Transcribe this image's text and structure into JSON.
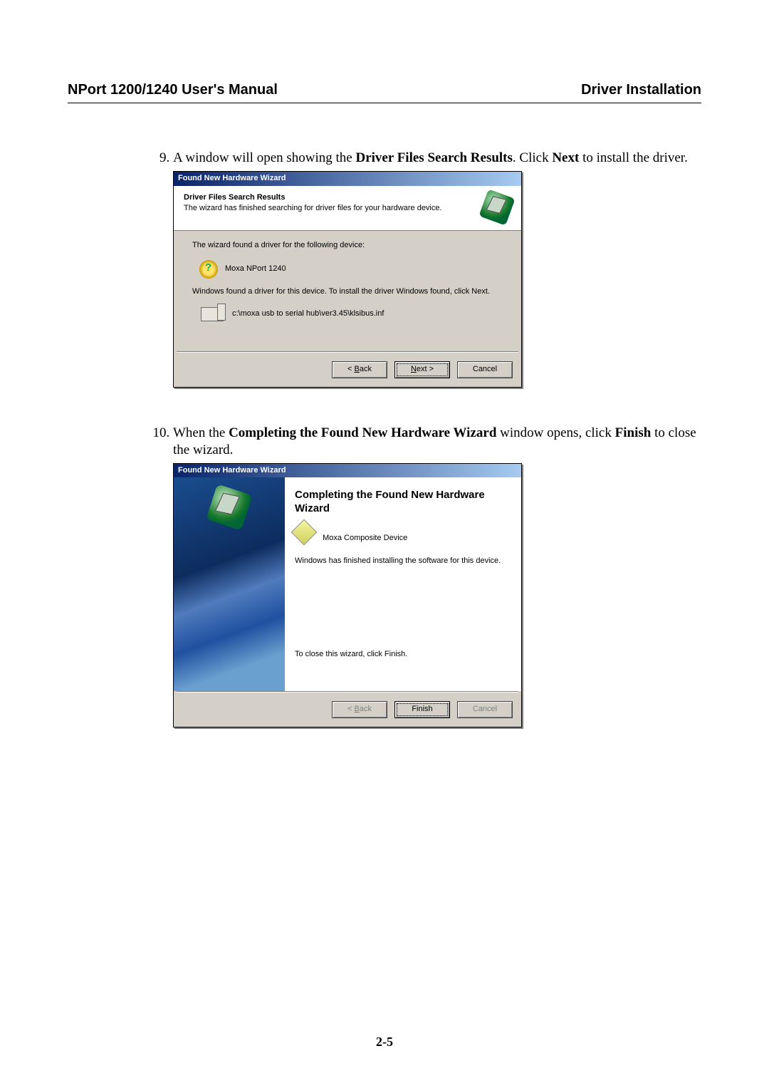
{
  "header": {
    "left": "NPort 1200/1240 User's Manual",
    "right": "Driver Installation"
  },
  "page_number": "2-5",
  "steps": {
    "s9": {
      "pre": "A window will open showing the ",
      "bold1": "Driver Files Search Results",
      "mid": ". Click ",
      "bold2": "Next",
      "post": " to install the driver."
    },
    "s10": {
      "pre": "When the ",
      "bold1": "Completing the Found New Hardware Wizard",
      "mid": " window opens, click ",
      "bold2": "Finish",
      "post": " to close the wizard."
    }
  },
  "wizard1": {
    "title": "Found New Hardware Wizard",
    "banner_title": "Driver Files Search Results",
    "banner_sub": "The wizard has finished searching for driver files for your hardware device.",
    "found_for": "The wizard found a driver for the following device:",
    "device": "Moxa NPort 1240",
    "windows_found": "Windows found a driver for this device. To install the driver Windows found, click Next.",
    "driver_path": "c:\\moxa usb to serial hub\\ver3.45\\klsibus.inf",
    "back": "Back",
    "next": "Next >",
    "cancel": "Cancel"
  },
  "wizard2": {
    "title": "Found New Hardware Wizard",
    "heading": "Completing the Found New Hardware Wizard",
    "device": "Moxa Composite Device",
    "finished": "Windows has finished installing the software for this device.",
    "close_hint": "To close this wizard, click Finish.",
    "back": "Back",
    "finish": "Finish",
    "cancel": "Cancel"
  }
}
